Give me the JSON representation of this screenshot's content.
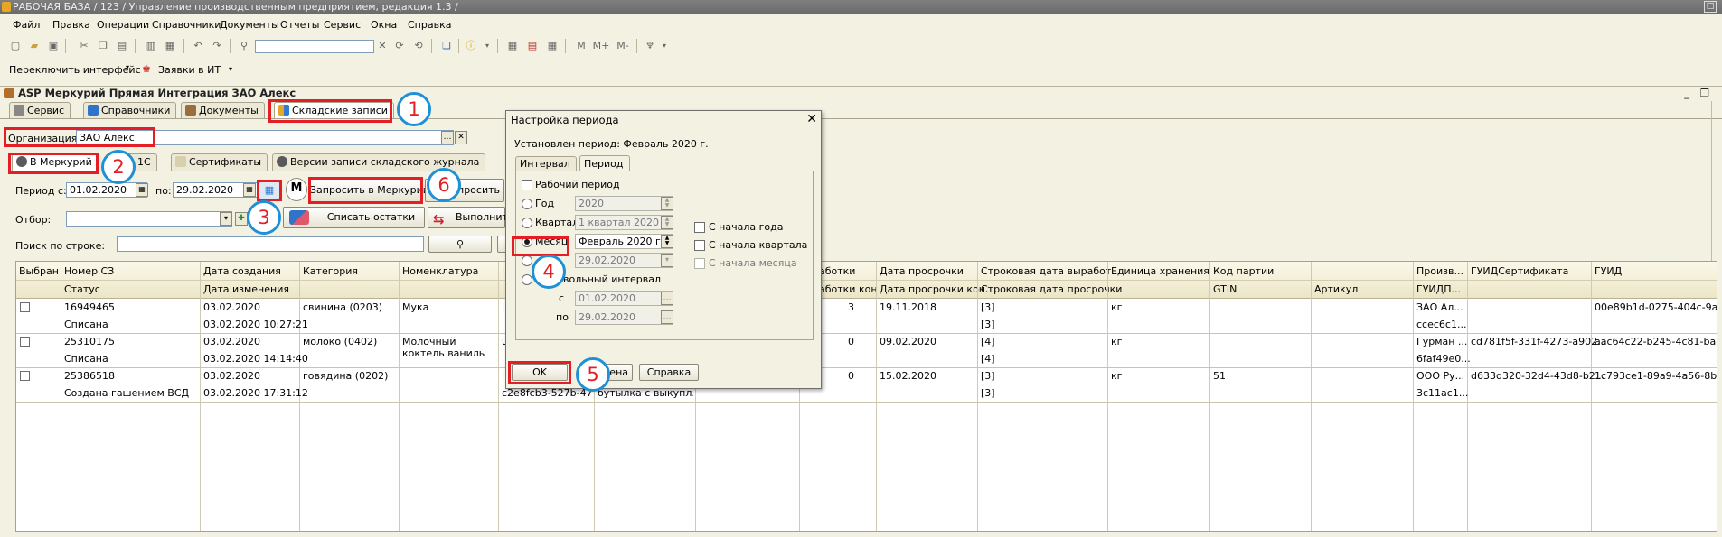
{
  "window": {
    "title": "РАБОЧАЯ БАЗА / 123 / Управление производственным предприятием, редакция 1.3 /"
  },
  "menu": [
    "Файл",
    "Правка",
    "Операции",
    "Справочники",
    "Документы",
    "Отчеты",
    "Сервис",
    "Окна",
    "Справка"
  ],
  "toolbar2": {
    "switch_interface": "Переключить интерфейс",
    "it_requests": "Заявки в ИТ"
  },
  "form": {
    "title": "ASP Меркурий Прямая Интеграция ЗАО Алекс",
    "tabs": [
      "Сервис",
      "Справочники",
      "Документы",
      "Складские записи"
    ],
    "org_label": "Организация:",
    "org_value": "ЗАО Алекс",
    "subtabs": [
      "В Меркурий",
      "в 1С",
      "Сертификаты",
      "Версии записи складского журнала"
    ],
    "period_from_label": "Период с:",
    "period_from": "01.02.2020",
    "period_to_label": "по:",
    "period_to": "29.02.2020",
    "request_btn": "Запросить в Меркурий",
    "request_btn2": "Запросить",
    "filter_label": "Отбор:",
    "writeoff_btn": "Списать остатки",
    "execute_btn": "Выполнить",
    "search_label": "Поиск по строке:"
  },
  "table": {
    "headers_top": [
      "Выбран",
      "Номер СЗ",
      "Дата создания",
      "Категория",
      "Номенклатура",
      "",
      "",
      "",
      "аботки",
      "Дата просрочки",
      "Строковая дата выработ...",
      "Единица хранения",
      "Код партии",
      "",
      "Произв...",
      "ГУИДСертификата",
      "ГУИД"
    ],
    "headers_bottom": [
      "",
      "Статус",
      "Дата изменения",
      "",
      "",
      "",
      "",
      "",
      "аботки кон",
      "Дата просрочки кон",
      "Строковая дата просрочки",
      "",
      "GTIN",
      "Артикул",
      "ГУИДП...",
      "",
      ""
    ],
    "rows": [
      {
        "num": "16949465",
        "status": "Списана",
        "created": "03.02.2020",
        "changed": "03.02.2020 10:27:21",
        "category": "свинина (0203)",
        "nomen": "Мука",
        "c6": "",
        "c7": "",
        "c8a": "3",
        "c8b": "",
        "exp": "19.11.2018",
        "str1": "[3]",
        "str2": "[3]",
        "unit": "кг",
        "lot": "",
        "prod": "ЗАО Ал...",
        "prod2": "ccec6c1...",
        "guidcert": "",
        "guid": "00e89b1d-0275-404c-9af..."
      },
      {
        "num": "25310175",
        "status": "Списана",
        "created": "03.02.2020",
        "changed": "03.02.2020 14:14:40",
        "category": "молоко (0402)",
        "nomen": "Молочный коктель ваниль",
        "c6": "",
        "c7": "",
        "c8a": "0",
        "c8b": "",
        "exp": "09.02.2020",
        "str1": "[4]",
        "str2": "[4]",
        "unit": "кг",
        "lot": "",
        "prod": "Гурман ...",
        "prod2": "6faf49e0...",
        "guidcert": "cd781f5f-331f-4273-a902...",
        "guid": "aac64c22-b245-4c81-ba..."
      },
      {
        "num": "25386518",
        "status": "Создана гашением ВСД",
        "created": "03.02.2020",
        "changed": "03.02.2020 17:31:12",
        "category": "говядина (0202)",
        "nomen": "",
        "c6": "",
        "c6b": "c2e8fcb3-527b-47...",
        "c7": "",
        "c7b": "бутылка с выкупл...",
        "c8a": "0",
        "c8b": "",
        "exp": "15.02.2020",
        "str1": "[3]",
        "str2": "[3]",
        "unit": "кг",
        "lot": "51",
        "prod": "ООО Ру...",
        "prod2": "3c11ac1...",
        "guidcert": "d633d320-32d4-43d8-b2...",
        "guid": "1c793ce1-89a9-4a56-8b..."
      }
    ]
  },
  "dialog": {
    "title": "Настройка периода",
    "current": "Установлен период: Февраль 2020 г.",
    "tabs": [
      "Интервал",
      "Период"
    ],
    "working_period": "Рабочий период",
    "year_label": "Год",
    "year_value": "2020",
    "quarter_label": "Квартал",
    "quarter_value": "1 квартал 2020 г.",
    "month_label": "Месяц",
    "month_value": "Февраль 2020 г.",
    "day_value": "29.02.2020",
    "arbitrary_label": "Произвольный интервал",
    "arbitrary_visible": "вольный интервал",
    "from_label": "с",
    "from_value": "01.02.2020",
    "to_label": "по",
    "to_value": "29.02.2020",
    "from_year_start": "С начала года",
    "from_quarter_start": "С начала квартала",
    "from_month_start": "С начала месяца",
    "ok": "OK",
    "cancel": "Отмена",
    "cancel_visible": "ена",
    "help": "Справка"
  },
  "markers": [
    "1",
    "2",
    "3",
    "4",
    "5",
    "6"
  ],
  "colors": {
    "highlight": "#e31e24",
    "marker_ring": "#1e90d6",
    "background": "#f3f1e1"
  }
}
